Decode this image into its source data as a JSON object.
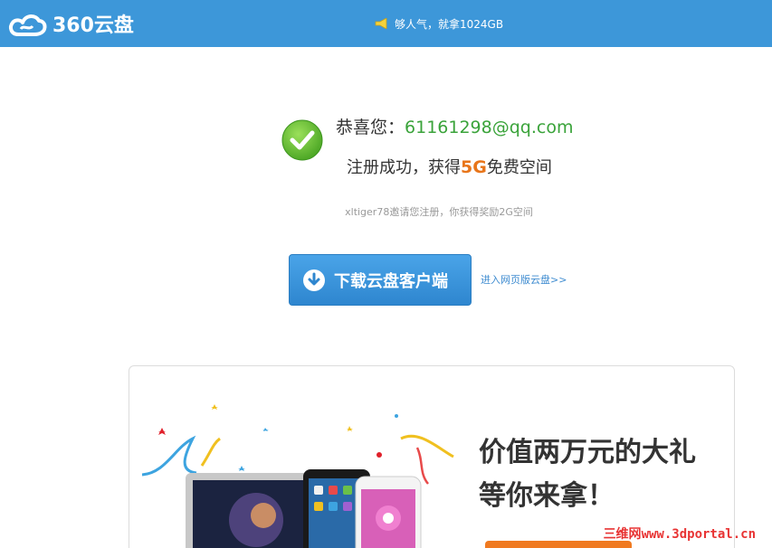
{
  "header": {
    "logo_text": "360云盘",
    "promo_text": "够人气，就拿1024GB"
  },
  "success": {
    "congrats_prefix": "恭喜您：",
    "email": "61161298@qq.com",
    "reg_prefix": "注册成功，获得",
    "reg_highlight": "5G",
    "reg_suffix": "免费空间",
    "invite_text": "xltiger78邀请您注册，你获得奖励2G空间"
  },
  "actions": {
    "download_label": "下载云盘客户端",
    "web_link_label": "进入网页版云盘>>"
  },
  "promo_card": {
    "line1": "价值两万元的大礼",
    "line2": "等你来拿！"
  },
  "watermark": {
    "text_cn": "三维网",
    "text_url": "www.3dportal.cn"
  },
  "colors": {
    "header_bg": "#3d97d9",
    "email_green": "#3aa33a",
    "highlight_orange": "#e8751a",
    "button_blue": "#2e86cf",
    "link_blue": "#3d8bd0"
  }
}
